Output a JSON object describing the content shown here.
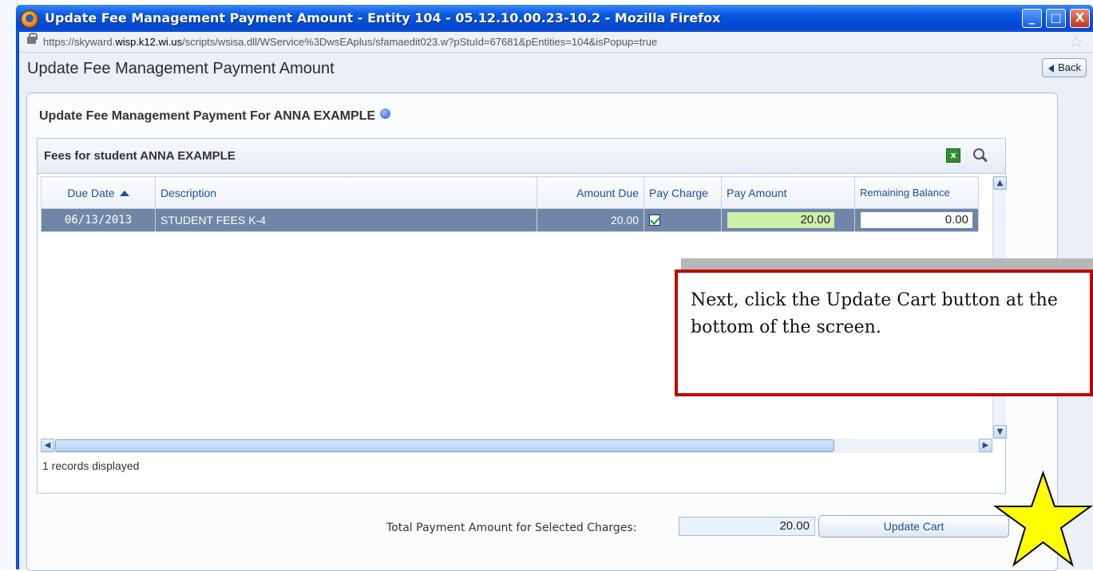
{
  "window": {
    "title": "Update Fee Management Payment Amount - Entity 104 - 05.12.10.00.23-10.2 - Mozilla Firefox",
    "controls": {
      "minimize": "_",
      "maximize": "□",
      "close": "X"
    }
  },
  "address_bar": {
    "url_prefix": "https://skyward.",
    "url_domain": "wisp.k12.wi.us",
    "url_path": "/scripts/wsisa.dll/WService%3DwsEAplus/sfamaedit023.w?pStuId=67681&pEntities=104&isPopup=true"
  },
  "page": {
    "heading": "Update Fee Management Payment Amount",
    "back_label": "Back"
  },
  "panel": {
    "title": "Update Fee Management Payment For ANNA EXAMPLE"
  },
  "grid": {
    "title": "Fees for student ANNA EXAMPLE",
    "export_icon": "excel-export-icon",
    "search_icon": "magnifier-icon",
    "columns": {
      "due_date": "Due Date",
      "description": "Description",
      "amount_due": "Amount Due",
      "pay_charge": "Pay Charge",
      "pay_amount": "Pay Amount",
      "remaining_balance": "Remaining Balance"
    },
    "rows": [
      {
        "due_date": "06/13/2013",
        "description": "STUDENT FEES K-4",
        "amount_due": "20.00",
        "pay_charge": true,
        "pay_amount": "20.00",
        "remaining_balance": "0.00"
      }
    ],
    "records_text": "1 records displayed"
  },
  "footer": {
    "total_label": "Total Payment Amount for Selected Charges:",
    "total_value": "20.00",
    "update_cart_label": "Update Cart"
  },
  "annotation": {
    "text": "Next, click the Update Cart button at the bottom of the screen.",
    "border_color": "#c00000",
    "star_color": "#ffff00"
  },
  "colors": {
    "selected_row": "#6f86a6",
    "pay_amount_field": "#ccf0a8",
    "titlebar": "#0a5ae3"
  }
}
